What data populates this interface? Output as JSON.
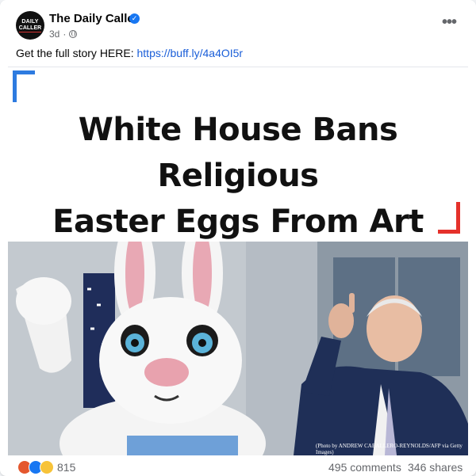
{
  "post": {
    "page_name": "The Daily Caller",
    "avatar_line1": "DAILY",
    "avatar_line2": "CALLER",
    "time": "3d",
    "separator": "·",
    "caption_text": "Get the full story HERE: ",
    "caption_link": "https://buff.ly/4a4OI5r"
  },
  "article": {
    "headline_line1": "White House Bans Religious",
    "headline_line2": "Easter Eggs From Art Contest",
    "photo_credit": "(Photo by ANDREW CABALLERO-REYNOLDS/AFP via Getty Images)"
  },
  "footer": {
    "reaction_count": "815",
    "comments": "495 comments",
    "shares": "346 shares"
  },
  "icons": {
    "more": "more-options-icon",
    "verified": "verified-badge-icon",
    "audience": "globe-icon",
    "reactions": [
      "angry-reaction-icon",
      "like-reaction-icon",
      "sad-reaction-icon"
    ]
  },
  "colors": {
    "link": "#1a5ed8",
    "accent_blue": "#2d7be0",
    "accent_red": "#e5312b",
    "meta_text": "#65676b"
  }
}
